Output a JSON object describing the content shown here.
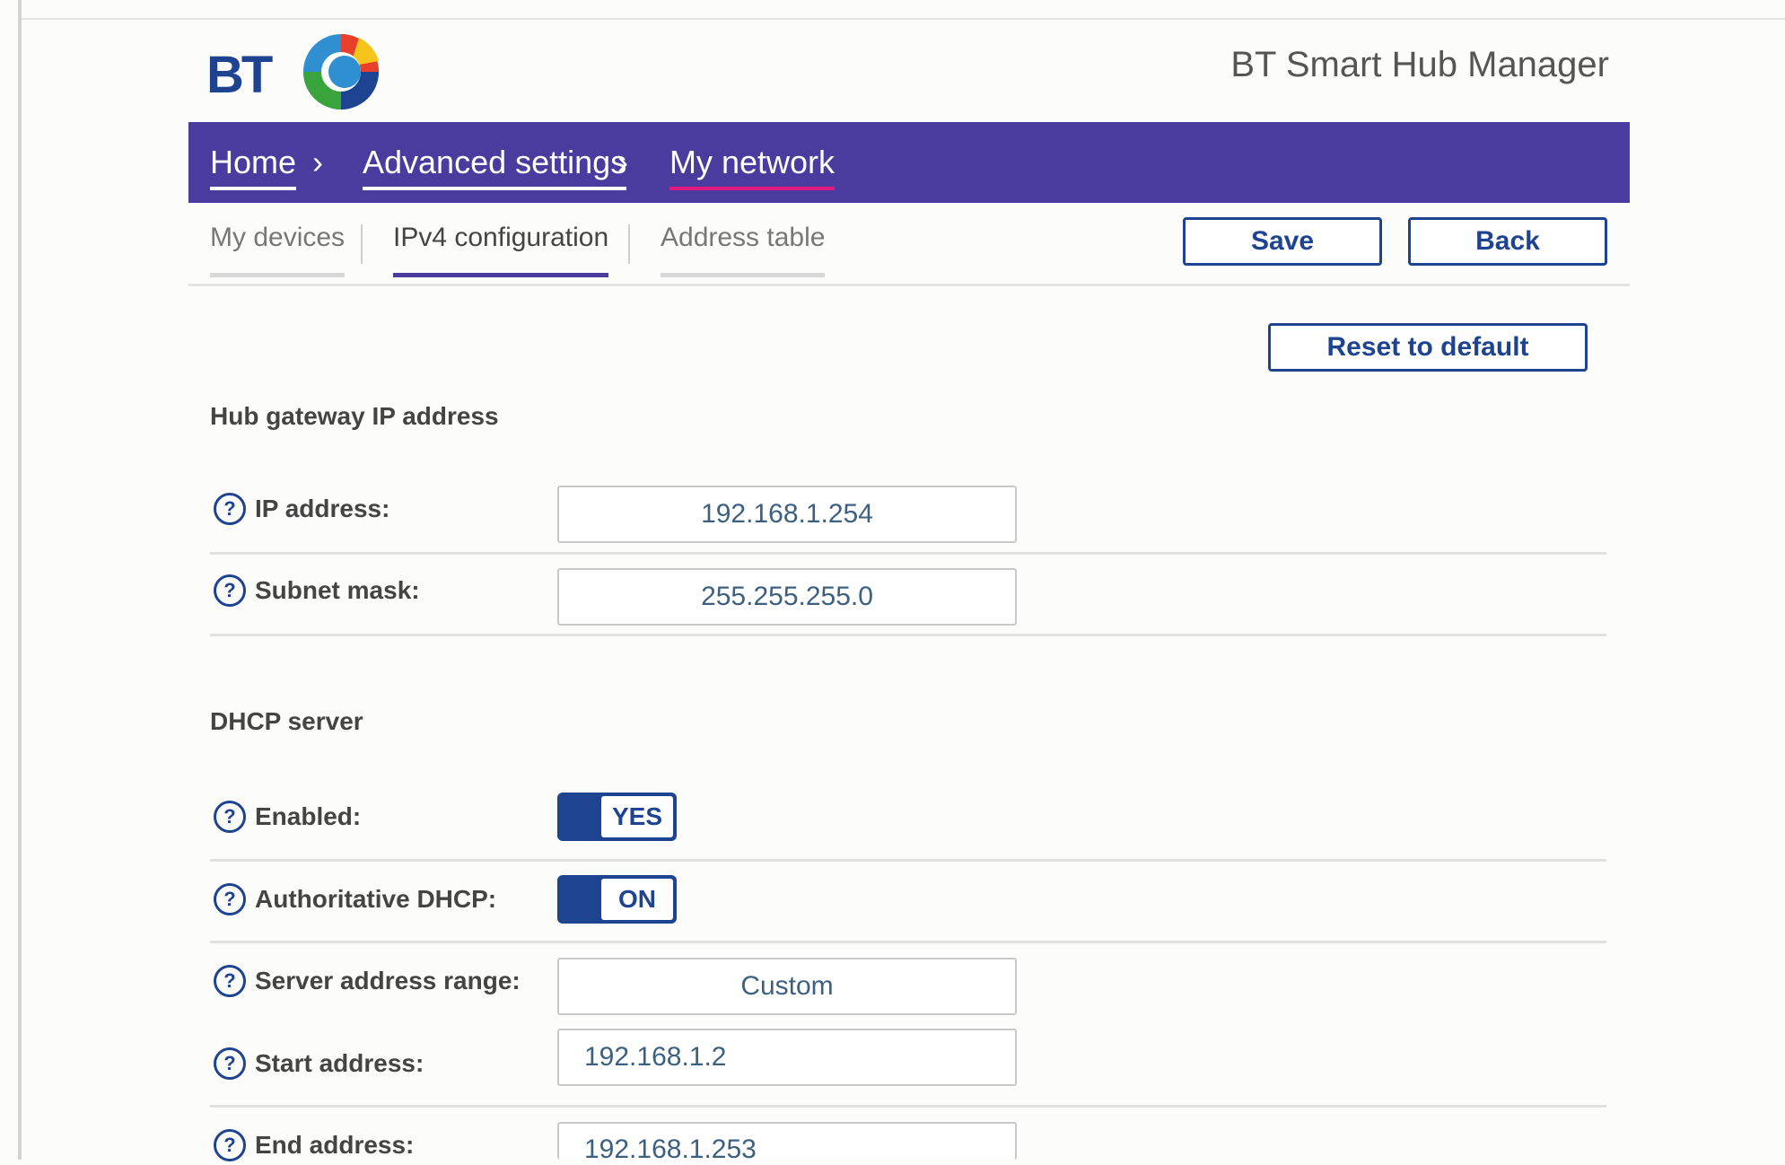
{
  "brand": {
    "logo_text": "BT",
    "app_title": "BT Smart Hub Manager"
  },
  "breadcrumb": [
    {
      "label": "Home"
    },
    {
      "label": "Advanced settings"
    },
    {
      "label": "My network"
    }
  ],
  "subtabs": [
    {
      "label": "My devices"
    },
    {
      "label": "IPv4 configuration",
      "active": true
    },
    {
      "label": "Address table"
    }
  ],
  "actions": {
    "save": "Save",
    "back": "Back",
    "reset": "Reset to default"
  },
  "hub_gateway": {
    "title": "Hub gateway IP address",
    "ip_label": "IP address:",
    "ip_value": "192.168.1.254",
    "subnet_label": "Subnet mask:",
    "subnet_value": "255.255.255.0"
  },
  "dhcp": {
    "title": "DHCP server",
    "enabled_label": "Enabled:",
    "enabled_value": "YES",
    "authoritative_label": "Authoritative DHCP:",
    "authoritative_value": "ON",
    "range_label": "Server address range:",
    "range_value": "Custom",
    "start_label": "Start address:",
    "start_value": "192.168.1.2",
    "end_label": "End address:",
    "end_value": "192.168.1.253"
  },
  "help_glyph": "?",
  "colors": {
    "nav": "#4a3b9e",
    "accent": "#1e4390",
    "active_crumb": "#e0187f"
  }
}
